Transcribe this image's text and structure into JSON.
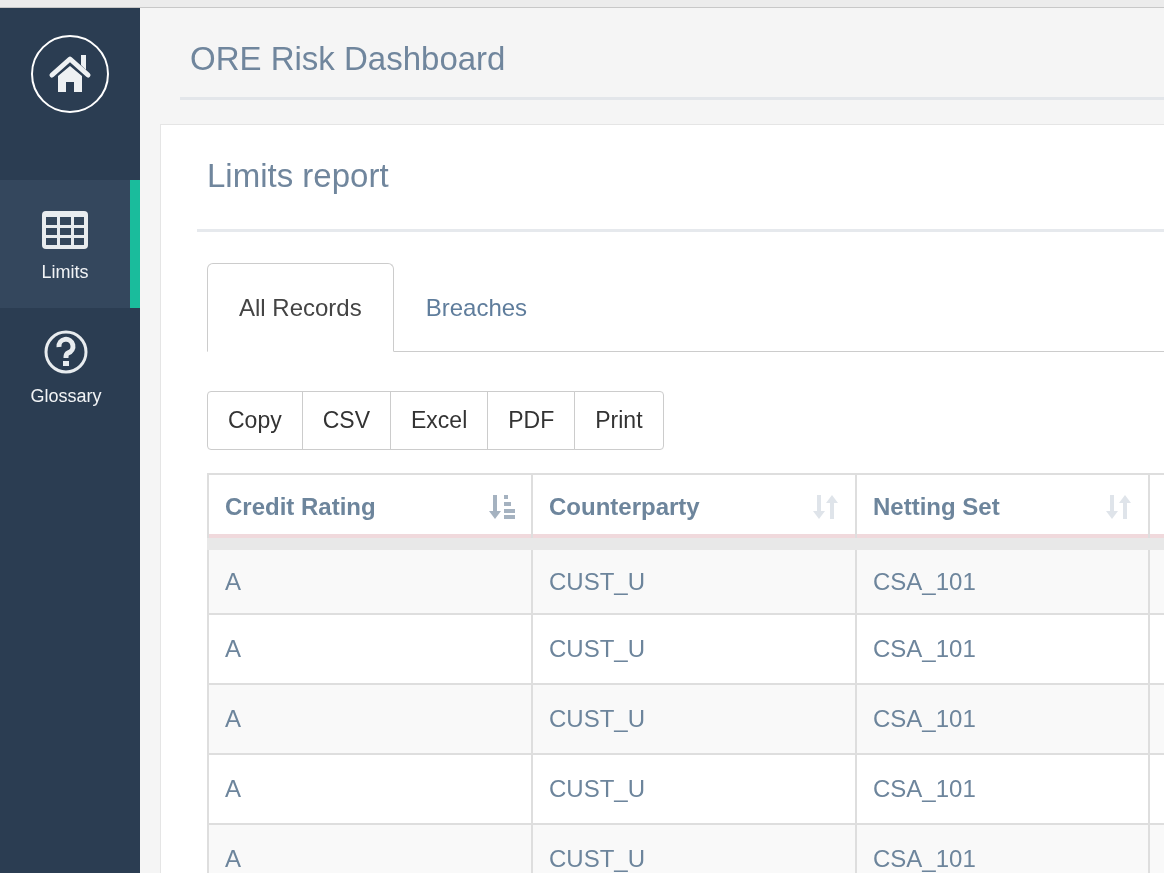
{
  "sidebar": {
    "items": [
      {
        "kind": "home",
        "selected": false
      },
      {
        "kind": "table",
        "label": "Limits",
        "selected": true
      },
      {
        "kind": "help",
        "label": "Glossary",
        "selected": false
      }
    ]
  },
  "header": {
    "title": "ORE Risk Dashboard"
  },
  "report": {
    "title": "Limits report",
    "tabs": [
      {
        "label": "All Records",
        "selected": true
      },
      {
        "label": "Breaches",
        "selected": false
      }
    ],
    "export_buttons": [
      "Copy",
      "CSV",
      "Excel",
      "PDF",
      "Print"
    ],
    "table": {
      "columns": [
        {
          "label": "Credit Rating",
          "sorted": true
        },
        {
          "label": "Counterparty",
          "sorted": false
        },
        {
          "label": "Netting Set",
          "sorted": false
        }
      ],
      "rows": [
        [
          "A",
          "CUST_U",
          "CSA_101"
        ],
        [
          "A",
          "CUST_U",
          "CSA_101"
        ],
        [
          "A",
          "CUST_U",
          "CSA_101"
        ],
        [
          "A",
          "CUST_U",
          "CSA_101"
        ],
        [
          "A",
          "CUST_U",
          "CSA_101"
        ]
      ]
    }
  }
}
